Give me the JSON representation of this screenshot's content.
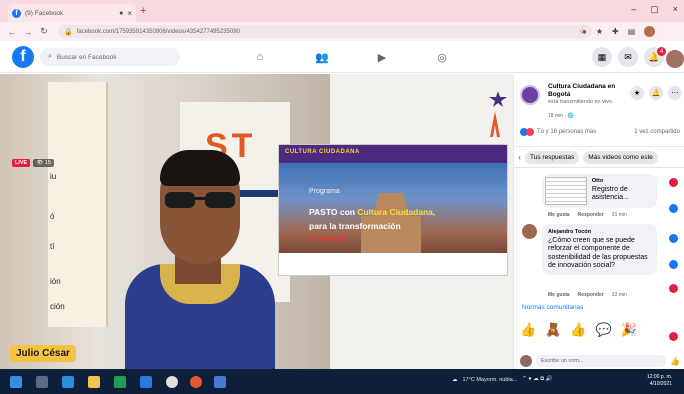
{
  "browser": {
    "tab_title": "(9) Facebook",
    "tab_audio": "●",
    "tab_close": "×",
    "new_tab": "+",
    "url": "facebook.com/175935914350906/videos/4354277495235090",
    "win_min": "–",
    "win_max": "▢",
    "win_close": "×"
  },
  "fb": {
    "search_placeholder": "Buscar en Facebook",
    "notif_count": "4",
    "brand_color": "#1877f2"
  },
  "video": {
    "live_label": "LIVE",
    "viewer_count": "15",
    "presenter_name": "Julio César",
    "poster_text": "ST",
    "paper_lines": [
      "iu",
      "ó",
      "tí",
      "ión",
      "ción"
    ],
    "slide": {
      "brand": "CULTURA CIUDADANA",
      "program_label": "Programa",
      "line1_a": "PASTO con ",
      "line1_b": "Cultura Ciudadana,",
      "line2": "para la transformación",
      "line3": "territorial"
    }
  },
  "panel": {
    "page_name": "Cultura Ciudadana en Bogotá",
    "page_sub": "está transmitiendo en vivo.",
    "page_time": "18 min",
    "reactions_text": "Tú y 16 personas más",
    "shares_text": "1 vez compartido",
    "tab_respuestas": "Tus respuestas",
    "tab_mas_videos": "Más videos como este",
    "comment1": {
      "author": "Otto",
      "text": "Registro de asistencia..."
    },
    "comment1_actions": [
      "Me gusta",
      "Responder",
      "31 min"
    ],
    "comment2": {
      "author": "Alejandro Tocón",
      "text": "¿Cómo creen que se puede reforzar el componente de sostenibilidad de las propuestas de innovación social?"
    },
    "comment2_actions": [
      "Me gusta",
      "Responder",
      "32 min"
    ],
    "notas_label": "Normas comunitarias",
    "emojis": [
      "👍",
      "🧸",
      "👍",
      "💬",
      "🎉"
    ],
    "comment_placeholder": "Escribe un com..."
  },
  "taskbar": {
    "weather": "17°C Mayorm. nubla...",
    "time": "12:00 p. m.",
    "date": "4/10/2021"
  }
}
